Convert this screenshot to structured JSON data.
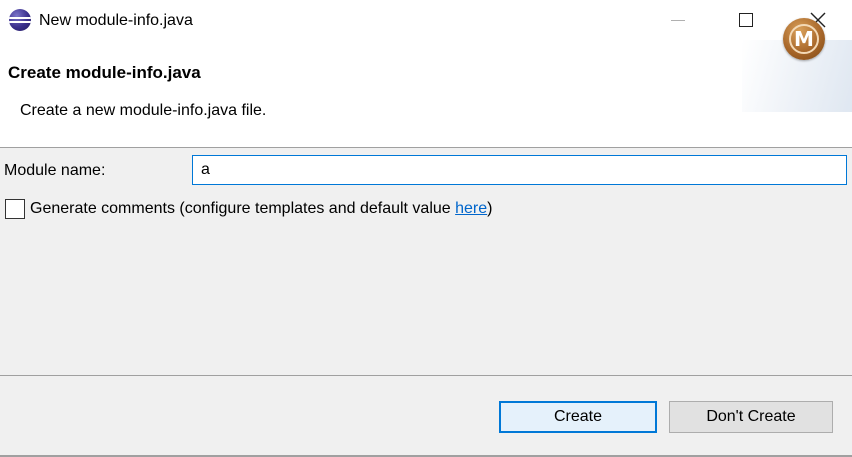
{
  "window": {
    "title": "New module-info.java",
    "app_icon": "eclipse-icon",
    "controls": {
      "minimize": "minimize-icon",
      "maximize": "maximize-icon",
      "close": "close-icon"
    }
  },
  "header": {
    "title": "Create module-info.java",
    "description": "Create a new module-info.java file.",
    "logo_letter": "M"
  },
  "form": {
    "module_name_label": "Module name:",
    "module_name_value": "a",
    "generate_comments_checked": false,
    "generate_comments_label": "Generate comments (configure templates and default value ",
    "here_link": "here",
    "closing_paren": ")"
  },
  "buttons": {
    "create": "Create",
    "dont_create": "Don't Create"
  },
  "colors": {
    "focus_accent": "#0078d7",
    "link": "#0066cc",
    "dialog_bg": "#f0f0f0"
  }
}
